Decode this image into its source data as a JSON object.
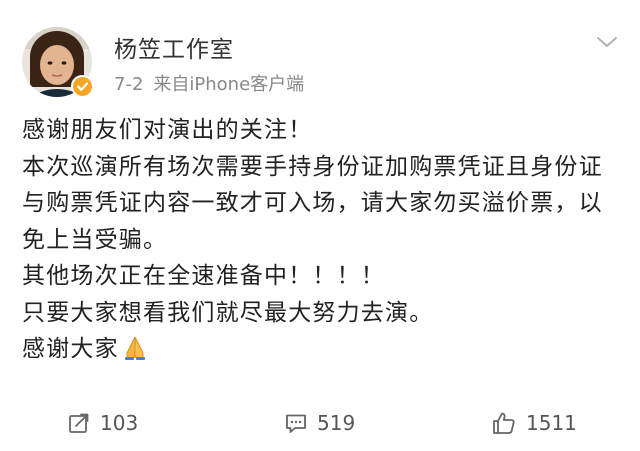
{
  "post": {
    "author": "杨笠工作室",
    "date": "7-2",
    "source": "来自iPhone客户端",
    "lines": [
      "感谢朋友们对演出的关注！",
      "本次巡演所有场次需要手持身份证加购票凭证且身份证与购票凭证内容一致才可入场，请大家勿买溢价票，以免上当受骗。",
      "其他场次正在全速准备中！！！！",
      "只要大家想看我们就尽最大努力去演。",
      "感谢大家"
    ],
    "emoji": "folded-hands-icon"
  },
  "actions": {
    "repost_count": "103",
    "comment_count": "519",
    "like_count": "1511"
  },
  "colors": {
    "verified_badge": "#f6a623",
    "text": "#222222",
    "meta": "#888888"
  }
}
